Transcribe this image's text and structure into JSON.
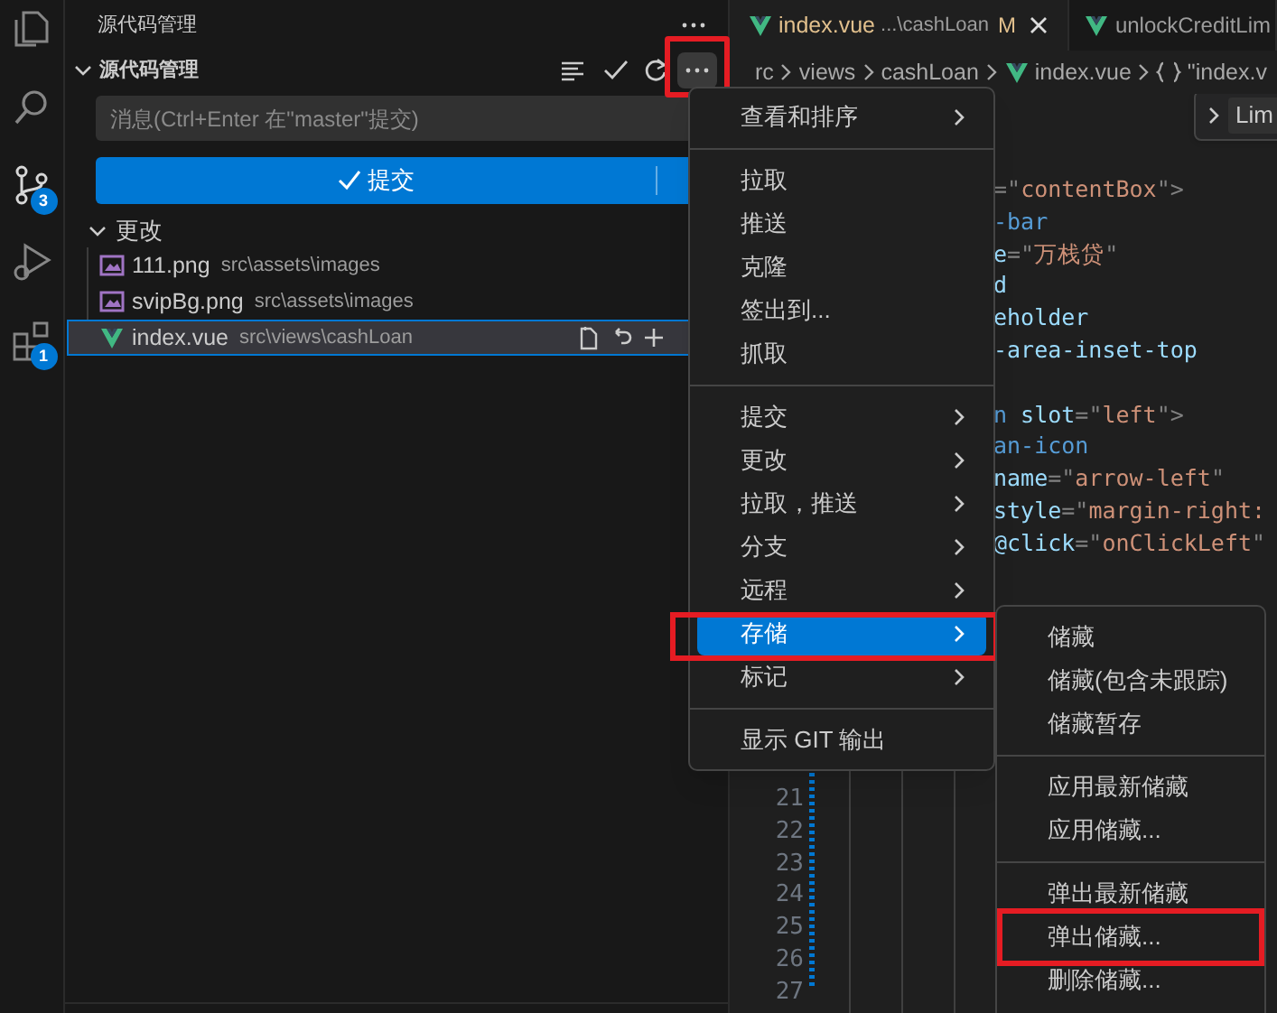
{
  "activity_bar": [
    {
      "kind": "files"
    },
    {
      "kind": "search"
    },
    {
      "kind": "source_control",
      "badge": "3",
      "selected": true
    },
    {
      "kind": "debug"
    },
    {
      "kind": "extensions",
      "badge": "1"
    }
  ],
  "sidebar": {
    "title": "源代码管理",
    "section": {
      "title": "源代码管理",
      "expanded": true,
      "more_highlighted": true
    },
    "message_input": {
      "placeholder": "消息(Ctrl+Enter 在\"master\"提交)"
    },
    "commit_button": {
      "label": "提交"
    },
    "changes": {
      "title": "更改",
      "expanded": true,
      "files": [
        {
          "name": "111.png",
          "path": "src\\assets\\images",
          "kind": "image",
          "selected": false
        },
        {
          "name": "svipBg.png",
          "path": "src\\assets\\images",
          "kind": "image",
          "selected": false
        },
        {
          "name": "index.vue",
          "path": "src\\views\\cashLoan",
          "kind": "vue",
          "selected": true
        }
      ]
    }
  },
  "editor": {
    "tabs": [
      {
        "label": "index.vue",
        "description": "...\\cashLoan",
        "status": "M",
        "selected": true
      },
      {
        "label": "unlockCreditLim",
        "selected": false
      }
    ],
    "breadcrumb": [
      {
        "label": "rc"
      },
      {
        "label": "views"
      },
      {
        "label": "cashLoan"
      },
      {
        "label": "index.vue",
        "kind": "vue"
      },
      {
        "label": "\"index.v",
        "kind": "braces"
      }
    ],
    "find_widget": {
      "value": "Lim"
    },
    "code_lines": [
      [
        {
          "kind": "punct",
          "text": "=\""
        },
        {
          "kind": "string",
          "text": "contentBox"
        },
        {
          "kind": "punct",
          "text": "\">"
        }
      ],
      [
        {
          "kind": "tag",
          "text": "-bar"
        }
      ],
      [
        {
          "kind": "attr",
          "text": "e"
        },
        {
          "kind": "punct",
          "text": "=\""
        },
        {
          "kind": "string",
          "text": "万栈贷"
        },
        {
          "kind": "punct",
          "text": "\""
        }
      ],
      [
        {
          "kind": "attr",
          "text": "d"
        }
      ],
      [
        {
          "kind": "attr",
          "text": "eholder"
        }
      ],
      [
        {
          "kind": "attr",
          "text": "-area-inset-top"
        }
      ],
      {
        "blank_before": true,
        "tokens": [
          {
            "kind": "tag",
            "text": "n"
          },
          {
            "kind": "attr",
            "text": " slot"
          },
          {
            "kind": "punct",
            "text": "=\""
          },
          {
            "kind": "string",
            "text": "left"
          },
          {
            "kind": "punct",
            "text": "\">"
          }
        ]
      },
      [
        {
          "kind": "tag",
          "text": "an-icon"
        }
      ],
      [
        {
          "kind": "attr",
          "text": "name"
        },
        {
          "kind": "punct",
          "text": "=\""
        },
        {
          "kind": "string",
          "text": "arrow-left"
        },
        {
          "kind": "punct",
          "text": "\""
        }
      ],
      [
        {
          "kind": "attr",
          "text": "style"
        },
        {
          "kind": "punct",
          "text": "=\""
        },
        {
          "kind": "string",
          "text": "margin-right:"
        }
      ],
      [
        {
          "kind": "attr",
          "text": "@click"
        },
        {
          "kind": "punct",
          "text": "=\""
        },
        {
          "kind": "string",
          "text": "onClickLeft"
        },
        {
          "kind": "punct",
          "text": "\""
        }
      ]
    ],
    "line_numbers": [
      "21",
      "22",
      "23",
      "24",
      "25",
      "26",
      "27"
    ]
  },
  "menu": {
    "groups": [
      [
        {
          "label": "查看和排序",
          "submenu": true,
          "selected": false,
          "highlighted": false
        }
      ],
      [
        {
          "label": "拉取",
          "submenu": false,
          "selected": false,
          "highlighted": false
        },
        {
          "label": "推送",
          "submenu": false,
          "selected": false,
          "highlighted": false
        },
        {
          "label": "克隆",
          "submenu": false,
          "selected": false,
          "highlighted": false
        },
        {
          "label": "签出到...",
          "submenu": false,
          "selected": false,
          "highlighted": false
        },
        {
          "label": "抓取",
          "submenu": false,
          "selected": false,
          "highlighted": false
        }
      ],
      [
        {
          "label": "提交",
          "submenu": true,
          "selected": false,
          "highlighted": false
        },
        {
          "label": "更改",
          "submenu": true,
          "selected": false,
          "highlighted": false
        },
        {
          "label": "拉取，推送",
          "submenu": true,
          "selected": false,
          "highlighted": false
        },
        {
          "label": "分支",
          "submenu": true,
          "selected": false,
          "highlighted": false
        },
        {
          "label": "远程",
          "submenu": true,
          "selected": false,
          "highlighted": false
        },
        {
          "label": "存储",
          "submenu": true,
          "selected": true,
          "highlighted": true
        },
        {
          "label": "标记",
          "submenu": true,
          "selected": false,
          "highlighted": false
        }
      ],
      [
        {
          "label": "显示 GIT 输出",
          "submenu": false,
          "selected": false,
          "highlighted": false
        }
      ]
    ]
  },
  "submenu": {
    "groups": [
      [
        {
          "label": "储藏",
          "highlighted": false
        },
        {
          "label": "储藏(包含未跟踪)",
          "highlighted": false
        },
        {
          "label": "储藏暂存",
          "highlighted": false
        }
      ],
      [
        {
          "label": "应用最新储藏",
          "highlighted": false
        },
        {
          "label": "应用储藏...",
          "highlighted": false
        }
      ],
      [
        {
          "label": "弹出最新储藏",
          "highlighted": false
        },
        {
          "label": "弹出储藏...",
          "highlighted": true
        },
        {
          "label": "删除储藏...",
          "highlighted": false
        }
      ]
    ]
  }
}
